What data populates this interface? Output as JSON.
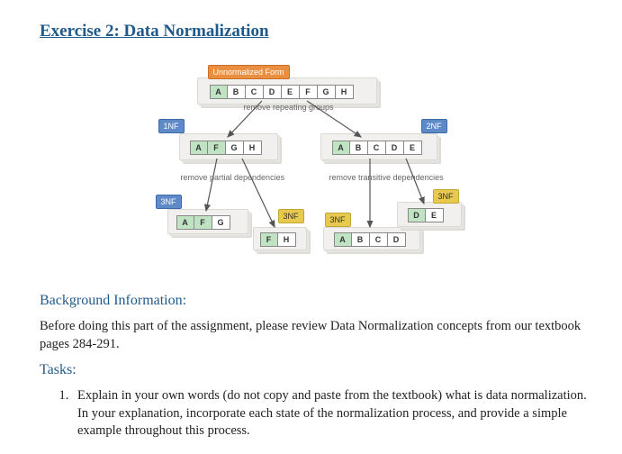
{
  "title": "Exercise 2: Data Normalization",
  "diagram": {
    "unf_label": "Unnormalized Form",
    "nf1_label": "1NF",
    "nf2_label": "2NF",
    "nf3_left": "3NF",
    "nf3_mid1": "3NF",
    "nf3_mid2": "3NF",
    "nf3_right": "3NF",
    "cap_repeat": "remove repeating groups",
    "cap_partial": "remove partial dependencies",
    "cap_trans": "remove transitive dependencies",
    "unf": {
      "c1": "A",
      "c2": "B",
      "c3": "C",
      "c4": "D",
      "c5": "E",
      "c6": "F",
      "c7": "G",
      "c8": "H"
    },
    "r1left": {
      "c1": "A",
      "c2": "F",
      "c3": "G",
      "c4": "H"
    },
    "r1right": {
      "c1": "A",
      "c2": "B",
      "c3": "C",
      "c4": "D",
      "c5": "E"
    },
    "r2a": {
      "c1": "A",
      "c2": "F",
      "c3": "G"
    },
    "r2b": {
      "c1": "F",
      "c2": "H"
    },
    "r2c": {
      "c1": "D",
      "c2": "E"
    },
    "r2d": {
      "c1": "A",
      "c2": "B",
      "c3": "C",
      "c4": "D"
    }
  },
  "background_heading": "Background Information:",
  "background_text": "Before doing this part of the assignment, please review Data Normalization concepts from our textbook pages 284-291.",
  "tasks_heading": "Tasks:",
  "task1": "Explain in your own words (do not copy and paste from the textbook) what is data normalization. In your explanation, incorporate each state of the normalization process, and provide a simple example throughout this process."
}
